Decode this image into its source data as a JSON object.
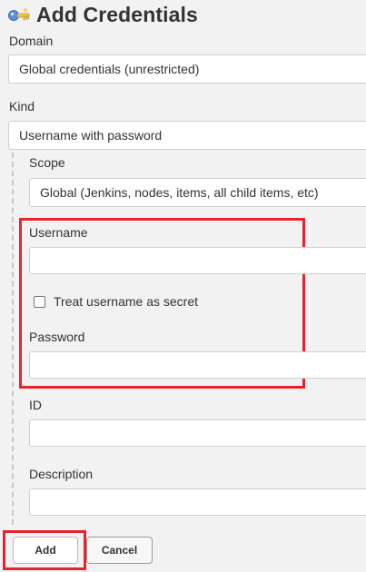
{
  "header": {
    "title": "Add Credentials",
    "icon": "key-icon"
  },
  "domain": {
    "label": "Domain",
    "value": "Global credentials (unrestricted)"
  },
  "kind": {
    "label": "Kind",
    "value": "Username with password"
  },
  "scope": {
    "label": "Scope",
    "value": "Global (Jenkins, nodes, items, all child items, etc)"
  },
  "username": {
    "label": "Username",
    "value": ""
  },
  "treat_secret": {
    "label": "Treat username as secret",
    "checked": false
  },
  "password": {
    "label": "Password",
    "value": ""
  },
  "id": {
    "label": "ID",
    "value": ""
  },
  "description": {
    "label": "Description",
    "value": ""
  },
  "buttons": {
    "add": "Add",
    "cancel": "Cancel"
  },
  "colors": {
    "highlight": "#e8232e",
    "background": "#f2f2f2"
  }
}
